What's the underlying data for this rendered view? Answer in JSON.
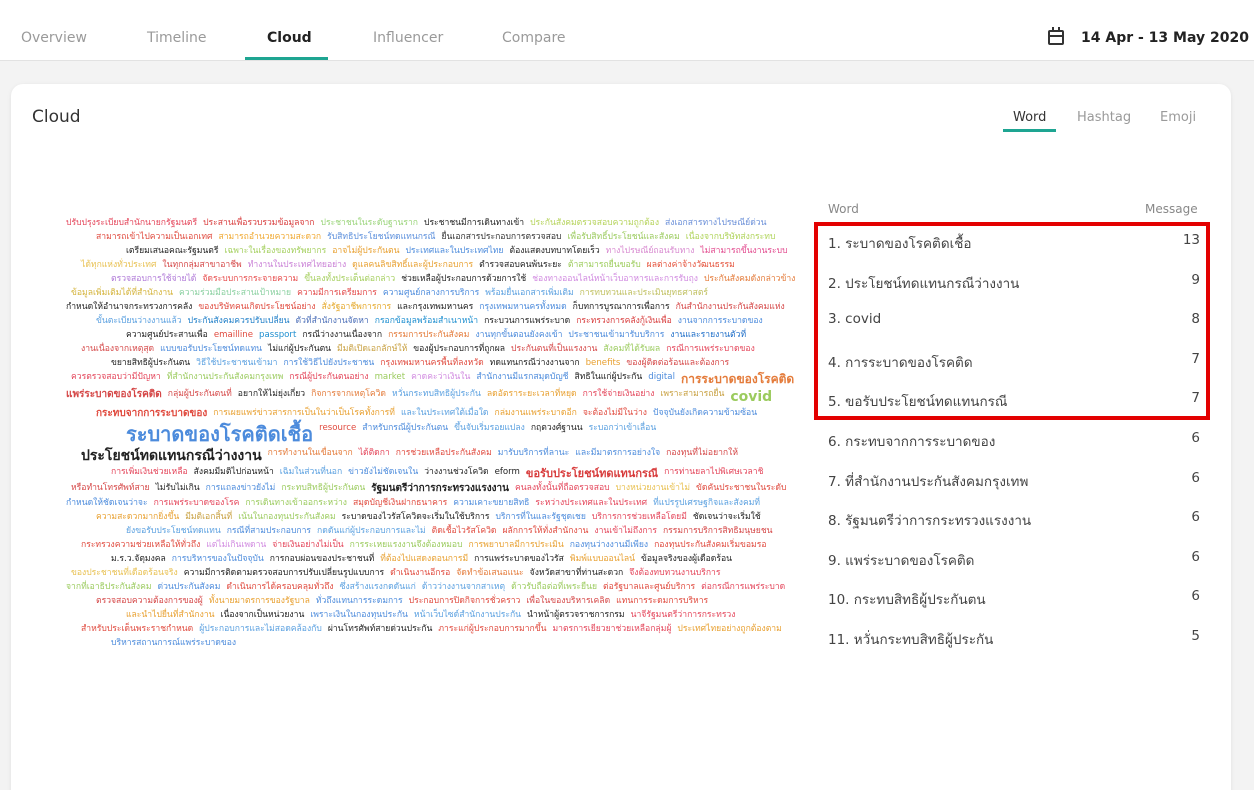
{
  "nav": {
    "tabs": [
      "Overview",
      "Timeline",
      "Cloud",
      "Influencer",
      "Compare"
    ],
    "active": "Cloud",
    "date_range": "14 Apr - 13 May 2020"
  },
  "card": {
    "title": "Cloud",
    "subtabs": [
      "Word",
      "Hashtag",
      "Emoji"
    ],
    "active_subtab": "Word"
  },
  "word_list": {
    "header_word": "Word",
    "header_message": "Message",
    "rows": [
      {
        "word": "1. ระบาดของโรคติดเชื้อ",
        "count": "13"
      },
      {
        "word": "2. ประโยชน์ทดแทนกรณีว่างงาน",
        "count": "9"
      },
      {
        "word": "3. covid",
        "count": "8"
      },
      {
        "word": "4. การระบาดของโรคติด",
        "count": "7"
      },
      {
        "word": "5. ขอรับประโยชน์ทดแทนกรณี",
        "count": "7"
      },
      {
        "word": "6. กระทบจากการระบาดของ",
        "count": "6"
      },
      {
        "word": "7. ที่สำนักงานประกันสังคมกรุงเทพ",
        "count": "6"
      },
      {
        "word": "8. รัฐมนตรีว่าการกระทรวงแรงงาน",
        "count": "6"
      },
      {
        "word": "9. แพร่ระบาดของโรคติด",
        "count": "6"
      },
      {
        "word": "10. กระทบสิทธิผู้ประกันตน",
        "count": "6"
      },
      {
        "word": "11. หวั่นกระทบสิทธิผู้ประกัน",
        "count": "5"
      }
    ],
    "highlight_color": "#e30000"
  },
  "cloud_words": [
    {
      "t": "ปรับปรุงระเบียบสำนักนายกรัฐมนตรี",
      "c": "#e4455a"
    },
    {
      "t": "ประสานเพื่อรวบรวมข้อมูลจาก",
      "c": "#d83c3c"
    },
    {
      "t": "ประชาชนในระดับฐานราก",
      "c": "#9ad47a"
    },
    {
      "t": "ประชาชนมีการเดินทางเข้า",
      "c": "#222222"
    },
    {
      "t": "ประกันสังคมตรวจสอบความถูกต้อง",
      "c": "#b5d35a"
    },
    {
      "t": "ส่งเอกสารทางไปรษณีย์ด่วน",
      "c": "#6a8fd8"
    },
    {
      "t": "สามารถเข้าไปความเป็นเอกเทศ",
      "c": "#e04a3e"
    },
    {
      "t": "สามารถอำนวยความสะดวก",
      "c": "#f0a830"
    },
    {
      "t": "รับสิทธิประโยชน์ทดแทนกรณี",
      "c": "#5b8fdc"
    },
    {
      "t": "ยื่นเอกสารประกอบการตรวจสอบ",
      "c": "#333333"
    },
    {
      "t": "เพื่อรับสิทธิ์ประโยชน์และสังคม",
      "c": "#9bcb5e"
    },
    {
      "t": "เนื่องจากบริษัทส่งกระทบ",
      "c": "#b0d45a"
    },
    {
      "t": "เตรียมเสนอคณะรัฐมนตรี",
      "c": "#222222"
    },
    {
      "t": "เฉพาะในเรื่องของทรัพยากร",
      "c": "#a5d060"
    },
    {
      "t": "อาจไม่ผู้ประกันตน",
      "c": "#e8a030"
    },
    {
      "t": "ประเทศและในประเทศไทย",
      "c": "#4c8bdc"
    },
    {
      "t": "ต้องแสดงบทบาทโดยเร็ว",
      "c": "#222222"
    },
    {
      "t": "ทางไปรษณีย์ถอนรับทาง",
      "c": "#d88ad0"
    },
    {
      "t": "ไม่สามารถขึ้นงานระบบ",
      "c": "#e24b8f"
    },
    {
      "t": "ได้ทุกแห่งทั่วประเทศ",
      "c": "#e8c050"
    },
    {
      "t": "ในทุกกลุ่มสาขาอาชีพ",
      "c": "#d54747"
    },
    {
      "t": "ทำงานในประเทศไทยอย่าง",
      "c": "#c97fd6"
    },
    {
      "t": "ดูแลคนลิขสิทธิ์และผู้ประกอบการ",
      "c": "#e8a030"
    },
    {
      "t": "ตำรวจสอบคนพ้นระยะ",
      "c": "#222222"
    },
    {
      "t": "ต้าสามารถยื่นขอรับ",
      "c": "#9ccc5a"
    },
    {
      "t": "ผลต่างค่าจ้างวัฒนธรรม",
      "c": "#e5533c"
    },
    {
      "t": "ตรวจสอบการใช้จ่ายได้",
      "c": "#b07ad8"
    },
    {
      "t": "จัดระบบการกระจายความ",
      "c": "#e74b4b"
    },
    {
      "t": "ขึ้นลงทั้งประเด็นต่อกล่าว",
      "c": "#a5cf5e"
    },
    {
      "t": "ช่วยเหลือผู้ประกอบการด้วยการใช้",
      "c": "#222222"
    },
    {
      "t": "ช่องทางออนไลน์หน้าเว็บอาหารและการรับถุง",
      "c": "#d18ae0"
    },
    {
      "t": "ประกันสังคมดังกล่าวข้าง",
      "c": "#e47b3a"
    },
    {
      "t": "ข้อมูลเพิ่มเติมได้ที่สำนักงาน",
      "c": "#d4b33a"
    },
    {
      "t": "ความร่วมมือประสานเป้าหมาย",
      "c": "#8ad0a0"
    },
    {
      "t": "ความมีการเตรียมการ",
      "c": "#e34b4b"
    },
    {
      "t": "ความศูนย์กลางการบริการ",
      "c": "#4c8bdc"
    },
    {
      "t": "พร้อมยื่นเอกสารเพิ่มเติม",
      "c": "#5aa0e0"
    },
    {
      "t": "การทบทวนและประเมินยุทธศาสตร์",
      "c": "#c0c060"
    },
    {
      "t": "กำหนดให้อำนาจกระทรวงการคลัง",
      "c": "#222222"
    },
    {
      "t": "ของบริษัทคนเกิดประโยชน์อย่าง",
      "c": "#e04a3e"
    },
    {
      "t": "สั่งรัฐอาชีพการการ",
      "c": "#e5a82a"
    },
    {
      "t": "และกรุงเทพมหานคร",
      "c": "#222222"
    },
    {
      "t": "กรุงเทพมหานครทั้งหมด",
      "c": "#4c8bdc"
    },
    {
      "t": "ก็บทการบูรณาการเพื่อการ",
      "c": "#222222"
    },
    {
      "t": "กันสำนักงานประกันสังคมแห่ง",
      "c": "#d54747"
    },
    {
      "t": "ขั้นตะเบียนว่างงานแล้ว",
      "c": "#5aa0e0"
    },
    {
      "t": "ประกันสังคมควรปรับเปลี่ยน",
      "c": "#1e7ec8"
    },
    {
      "t": "ตัวที่สำนักงานจัดหา",
      "c": "#4c6fb8"
    },
    {
      "t": "กรอกข้อมูลพร้อมสำเนาหน้า",
      "c": "#1e8fd0"
    },
    {
      "t": "กระบวนการแพร่ระบาด",
      "c": "#222222"
    },
    {
      "t": "กระทรวงการคลังกู้เงินเพื่อ",
      "c": "#d83c3c"
    },
    {
      "t": "งานจากการระบาดของ",
      "c": "#4c8bdc"
    },
    {
      "t": "ความศูนย์ประสานเพื่อ",
      "c": "#222222"
    },
    {
      "t": "emailline",
      "c": "#e04a3e"
    },
    {
      "t": "passport",
      "c": "#1e8fd0"
    },
    {
      "t": "กรณีว่างงานเนื่องจาก",
      "c": "#222222"
    },
    {
      "t": "กรรมการประกันสังคม",
      "c": "#e47b3a"
    },
    {
      "t": "งานทุกขั้นตอนยังคงเข้า",
      "c": "#4c8bdc"
    },
    {
      "t": "ประชาชนเข้ามารับบริการ",
      "c": "#4c8bdc"
    },
    {
      "t": "งานและรายงานตัวที่",
      "c": "#1e6ec8"
    },
    {
      "t": "งานเนื่องจากเหตุสุด",
      "c": "#d54747"
    },
    {
      "t": "แบบขอรับประโยชน์ทดแทน",
      "c": "#4c8bdc"
    },
    {
      "t": "ไม่แก่ผู้ประกันตน",
      "c": "#222222"
    },
    {
      "t": "มีมติเปิดเอกลักษ์ให้",
      "c": "#c8a040"
    },
    {
      "t": "ของผู้ประกอบการที่ถูกผล",
      "c": "#222222"
    },
    {
      "t": "ประกันตนที่เป็นแรงงาน",
      "c": "#d54747"
    },
    {
      "t": "สังคมที่ได้รับผล",
      "c": "#9bcb5e"
    },
    {
      "t": "กรณีการแพร่ระบาดของ",
      "c": "#e4455a"
    },
    {
      "t": "ขยายสิทธิผู้ประกันตน",
      "c": "#222222"
    },
    {
      "t": "วิธีใช้ประชาชนเข้ามา",
      "c": "#5aa0e0"
    },
    {
      "t": "การใช้วิธีไปยังประชาชน",
      "c": "#4c8bdc"
    },
    {
      "t": "กรุงเทพมหานครพื้นที่ลงหวัด",
      "c": "#e04a3e"
    },
    {
      "t": "ทดแทนกรณีว่างงานจาก",
      "c": "#222222"
    },
    {
      "t": "benefits",
      "c": "#e8a030"
    },
    {
      "t": "ของผู้ติดต่อร้อนและต้องการ",
      "c": "#d54747"
    },
    {
      "t": "ควรตรวจสอบว่ามีปัญหา",
      "c": "#e4455a"
    },
    {
      "t": "ที่สำนักงานประกันสังคมกรุงเทพ",
      "c": "#9bcb5e"
    },
    {
      "t": "กรณีผู้ประกันตนอย่าง",
      "c": "#e4455a"
    },
    {
      "t": "market",
      "c": "#9bcb5e"
    },
    {
      "t": "คาดคะว่าเงินใน",
      "c": "#d18ae0"
    },
    {
      "t": "สำนักงานมีแรกสมุดบัญชี",
      "c": "#4c8bdc"
    },
    {
      "t": "สิทธิในแก่ผู้ประกัน",
      "c": "#222222"
    },
    {
      "t": "digital",
      "c": "#4c8bdc"
    },
    {
      "t": "การระบาดของโรคติด",
      "c": "#e47b3a"
    },
    {
      "t": "แพร่ระบาดของโรคติด",
      "c": "#d54747"
    },
    {
      "t": "กลุ่มผู้ประกันตนที่",
      "c": "#d54747"
    },
    {
      "t": "อยากให้ไม่ยุ่งเกี่ยว",
      "c": "#222222"
    },
    {
      "t": "กิจการจากเหตุโควิด",
      "c": "#e47b3a"
    },
    {
      "t": "หวั่นกระทบสิทธิผู้ประกัน",
      "c": "#5aa0e0"
    },
    {
      "t": "ลดอัตราระยะเวลาที่หยุด",
      "c": "#e8a030"
    },
    {
      "t": "การใช้จ่ายเงินอย่าง",
      "c": "#e4455a"
    },
    {
      "t": "เพราะสามารถยื่น",
      "c": "#c8a040"
    },
    {
      "t": "covid",
      "c": "#9bcb5e"
    },
    {
      "t": "กระทบจากการระบาดของ",
      "c": "#e04a3e"
    },
    {
      "t": "การเผยแพร่ข่าวสารการเป็นในว่าเป็นโรคทั้งการที่",
      "c": "#e8a030"
    },
    {
      "t": "และในประเทศใต้เมื่อใด",
      "c": "#5aa0e0"
    },
    {
      "t": "กล่มงานแพร่ระบาดอีก",
      "c": "#e8a030"
    },
    {
      "t": "จะต้องไม่มีในว่าง",
      "c": "#e04a3e"
    },
    {
      "t": "ปัจจุบันยังเกิดความข้ามซ้อน",
      "c": "#4c8bdc"
    },
    {
      "t": "ระบาดของโรคติดเชื้อ",
      "c": "#4c8bdc"
    },
    {
      "t": "resource",
      "c": "#e04a3e"
    },
    {
      "t": "สำหรับกรณีผู้ประกันตน",
      "c": "#4c8bdc"
    },
    {
      "t": "ขึ้นจับเริ่มรอยแปลง",
      "c": "#5aa0e0"
    },
    {
      "t": "กฤตวงศ์ฐานน",
      "c": "#222222"
    },
    {
      "t": "ระบอกว่าเข้าเลื่อน",
      "c": "#5aa0e0"
    },
    {
      "t": "ประโยชน์ทดแทนกรณีว่างงาน",
      "c": "#222222"
    },
    {
      "t": "การทำงานในเขื่อนจาก",
      "c": "#e47b3a"
    },
    {
      "t": "ได้ติดกา",
      "c": "#e4455a"
    },
    {
      "t": "การช่วยเหลือประกันสังคม",
      "c": "#e04a3e"
    },
    {
      "t": "มารับบริการที่ลานะ",
      "c": "#4c8bdc"
    },
    {
      "t": "และมีมาตรการอย่างใจ",
      "c": "#4c8bdc"
    },
    {
      "t": "กองทุนที่ไม่อยากให้",
      "c": "#d54747"
    },
    {
      "t": "การเพิ่มเงินช่วยเหลือ",
      "c": "#e4455a"
    },
    {
      "t": "สังคมมีมติไปก่อนหน้า",
      "c": "#222222"
    },
    {
      "t": "เฉิมในส่วนที่นอก",
      "c": "#5aa0e0"
    },
    {
      "t": "ข่าวยังไม่ชัดเจนใน",
      "c": "#4c8bdc"
    },
    {
      "t": "ว่างงานช่วงโควิด",
      "c": "#222222"
    },
    {
      "t": "eform",
      "c": "#222222"
    },
    {
      "t": "ขอรับประโยชน์ทดแทนกรณี",
      "c": "#d83c3c"
    },
    {
      "t": "การท่านยลาไปพิเศษเวลาชิ",
      "c": "#e4455a"
    },
    {
      "t": "หรือทำนโทรศัพท์สาย",
      "c": "#d54747"
    },
    {
      "t": "ไม่รับไม่เกิน",
      "c": "#222222"
    },
    {
      "t": "การแถลงข่าวยังไม่",
      "c": "#4c8bdc"
    },
    {
      "t": "กระทบสิทธิผู้ประกันตน",
      "c": "#9bcb5e"
    },
    {
      "t": "รัฐมนตรีว่าการกระทรวงแรงงาน",
      "c": "#222222"
    },
    {
      "t": "คนลงทั้งนั้นที่ถือตรวจสอบ",
      "c": "#e4455a"
    },
    {
      "t": "บางหน่วยงานเข้าไม่",
      "c": "#e8c050"
    },
    {
      "t": "ขัดคันประชาชนในระดับ",
      "c": "#e04a3e"
    },
    {
      "t": "กำหนดให้ชัดเจนว่าจะ",
      "c": "#4c8bdc"
    },
    {
      "t": "การแพร่ระบาดของโรค",
      "c": "#e4455a"
    },
    {
      "t": "การเดินทางเข้าออกระหว่าง",
      "c": "#9bcb5e"
    },
    {
      "t": "สมุดบัญชีเงินฝากธนาคาร",
      "c": "#e04a3e"
    },
    {
      "t": "ความเคาะขยายสิทธิ",
      "c": "#4c8bdc"
    },
    {
      "t": "ระหว่างประเทศและในประเทศ",
      "c": "#e4455a"
    },
    {
      "t": "ที่แปรรูปเศรษฐกิจและสังคมที่",
      "c": "#5aa0e0"
    },
    {
      "t": "ความสะดวกมากยิ่งขึ้น",
      "c": "#e8a030"
    },
    {
      "t": "มีมติเอกสิ้นที่",
      "c": "#c8a040"
    },
    {
      "t": "เน้นในกองทุนประกันสังคม",
      "c": "#9bcb5e"
    },
    {
      "t": "ระบาดของไวรัสโควิดจะเริ่มในใช้บริการ",
      "c": "#222222"
    },
    {
      "t": "บริการที่ในและรัฐชุดเชย",
      "c": "#4c8bdc"
    },
    {
      "t": "บริการการช่วยเหลือโดยมี",
      "c": "#e4455a"
    },
    {
      "t": "ชัดเจนว่าจะเริ่มใช้",
      "c": "#222222"
    },
    {
      "t": "ยังขอรับประโยชน์ทดแทน",
      "c": "#5aa0e0"
    },
    {
      "t": "กรณีที่สามประกอบการ",
      "c": "#4c8bdc"
    },
    {
      "t": "กดดันแก่ผู้ประกอบการและไม่",
      "c": "#5aa0e0"
    },
    {
      "t": "ติดเชื้อไวรัสโควิด",
      "c": "#e04a3e"
    },
    {
      "t": "ผลักการให้ทั่งสำนักงาน",
      "c": "#e04a3e"
    },
    {
      "t": "งานเข้าไม่ถึงการ",
      "c": "#e4455a"
    },
    {
      "t": "กรรมการบริการสิทธิมนุษยชน",
      "c": "#d54747"
    },
    {
      "t": "กระทรวงความช่วยเหลือให้ทั่วถึง",
      "c": "#e04a3e"
    },
    {
      "t": "แต่ไม่เกินเพดาน",
      "c": "#d18ae0"
    },
    {
      "t": "จ่ายเงินอย่างไม่เป็น",
      "c": "#e4455a"
    },
    {
      "t": "การระเหยแรงงานจึงต้องหมอบ",
      "c": "#9bcb5e"
    },
    {
      "t": "การพยาบาลมีการประเมิน",
      "c": "#e8a030"
    },
    {
      "t": "กองทุนว่างงานมีเพียง",
      "c": "#4c8bdc"
    },
    {
      "t": "กองทุนประกันสังคมเริ่มขอมรอ",
      "c": "#e04a3e"
    },
    {
      "t": "ม.ร.ว.จัตุมงคล",
      "c": "#222222"
    },
    {
      "t": "การบริหารของในปัจจุบัน",
      "c": "#4c8bdc"
    },
    {
      "t": "การกอบผ่อนของประชาชนที่",
      "c": "#222222"
    },
    {
      "t": "ที่ต้องไปแสดงตอนการมี",
      "c": "#e8a030"
    },
    {
      "t": "การแพร่ระบาดของไวรัส",
      "c": "#222222"
    },
    {
      "t": "พิมพ์แบบออนไลน์",
      "c": "#e8a030"
    },
    {
      "t": "ข้อมูลจริงของผู้เดือดร้อน",
      "c": "#222222"
    },
    {
      "t": "ของประชาชนที่เดือดร้อนจริง",
      "c": "#e8c050"
    },
    {
      "t": "ความมีการติดตามตรวจสอบการปรับเปลี่ยนรูปแบบการ",
      "c": "#222222"
    },
    {
      "t": "ดำเนินงานอีกรอ",
      "c": "#e04a3e"
    },
    {
      "t": "จัดทำข้อเสนอแนะ",
      "c": "#e47b3a"
    },
    {
      "t": "จังหวัดสาขาที่ท่านสะดวก",
      "c": "#222222"
    },
    {
      "t": "จึงต้องทบทวนงานบริการ",
      "c": "#e4455a"
    },
    {
      "t": "จากที่เอาธิประกันสังคม",
      "c": "#9bcb5e"
    },
    {
      "t": "ด่วนประกันสังคม",
      "c": "#4c8bdc"
    },
    {
      "t": "ดำเนินการได้ครอบคลุมทั่วถึง",
      "c": "#e04a3e"
    },
    {
      "t": "ซึ่งสร้างแรงกดดันแก่",
      "c": "#5aa0e0"
    },
    {
      "t": "ด้าวว่างงานจากสาเหตุ",
      "c": "#5aa0e0"
    },
    {
      "t": "ด้าวรับถือต่อที่เพระยืนย",
      "c": "#9bcb5e"
    },
    {
      "t": "ต่อรัฐบาลและศูนย์บริการ",
      "c": "#e04a3e"
    },
    {
      "t": "ต่อกรณีการแพร่ระบาด",
      "c": "#e4455a"
    },
    {
      "t": "ตรวจสอบความต้องการของผู้",
      "c": "#d54747"
    },
    {
      "t": "ทั้งนายมาตรการของรัฐบาล",
      "c": "#e8a030"
    },
    {
      "t": "ทั่วถึงแทนการระดมการ",
      "c": "#4c8bdc"
    },
    {
      "t": "ประกอบการปิดกิจการชั่วคราว",
      "c": "#e04a3e"
    },
    {
      "t": "เพื่อในของบริหารเคลิด",
      "c": "#d54747"
    },
    {
      "t": "แทนการระดมการบริหาร",
      "c": "#e04a3e"
    },
    {
      "t": "และนำไปยื่นที่สำนักงาน",
      "c": "#e8a030"
    },
    {
      "t": "เนื่องจากเป็นหน่วยงาน",
      "c": "#222222"
    },
    {
      "t": "เพราะเงินในกองทุนประกัน",
      "c": "#4c8bdc"
    },
    {
      "t": "หน้าเว็บไซด์สำนักงานประกัน",
      "c": "#5aa0e0"
    },
    {
      "t": "นำหน้าผู้ตรวจราชการกรม",
      "c": "#222222"
    },
    {
      "t": "นาจีรัฐมนตรีว่าการกระทรวง",
      "c": "#e4455a"
    },
    {
      "t": "สำหรับประเด็นพระราชกำหนด",
      "c": "#e04a3e"
    },
    {
      "t": "ผู้ประกอบการและไม่สอดคล้องกับ",
      "c": "#5aa0e0"
    },
    {
      "t": "ผ่านโทรศัพท์สายด่วนประกัน",
      "c": "#222222"
    },
    {
      "t": "ภาระแก่ผู้ประกอบการมากขึ้น",
      "c": "#e04a3e"
    },
    {
      "t": "มาตรการเยียวยาช่วยเหลือกลุ่มผู้",
      "c": "#e4455a"
    },
    {
      "t": "ประเทศไทยอย่างถูกต้องตาม",
      "c": "#e8a030"
    },
    {
      "t": "บริหารสถานการณ์แพร่ระบาดของ",
      "c": "#4c8bdc"
    }
  ]
}
